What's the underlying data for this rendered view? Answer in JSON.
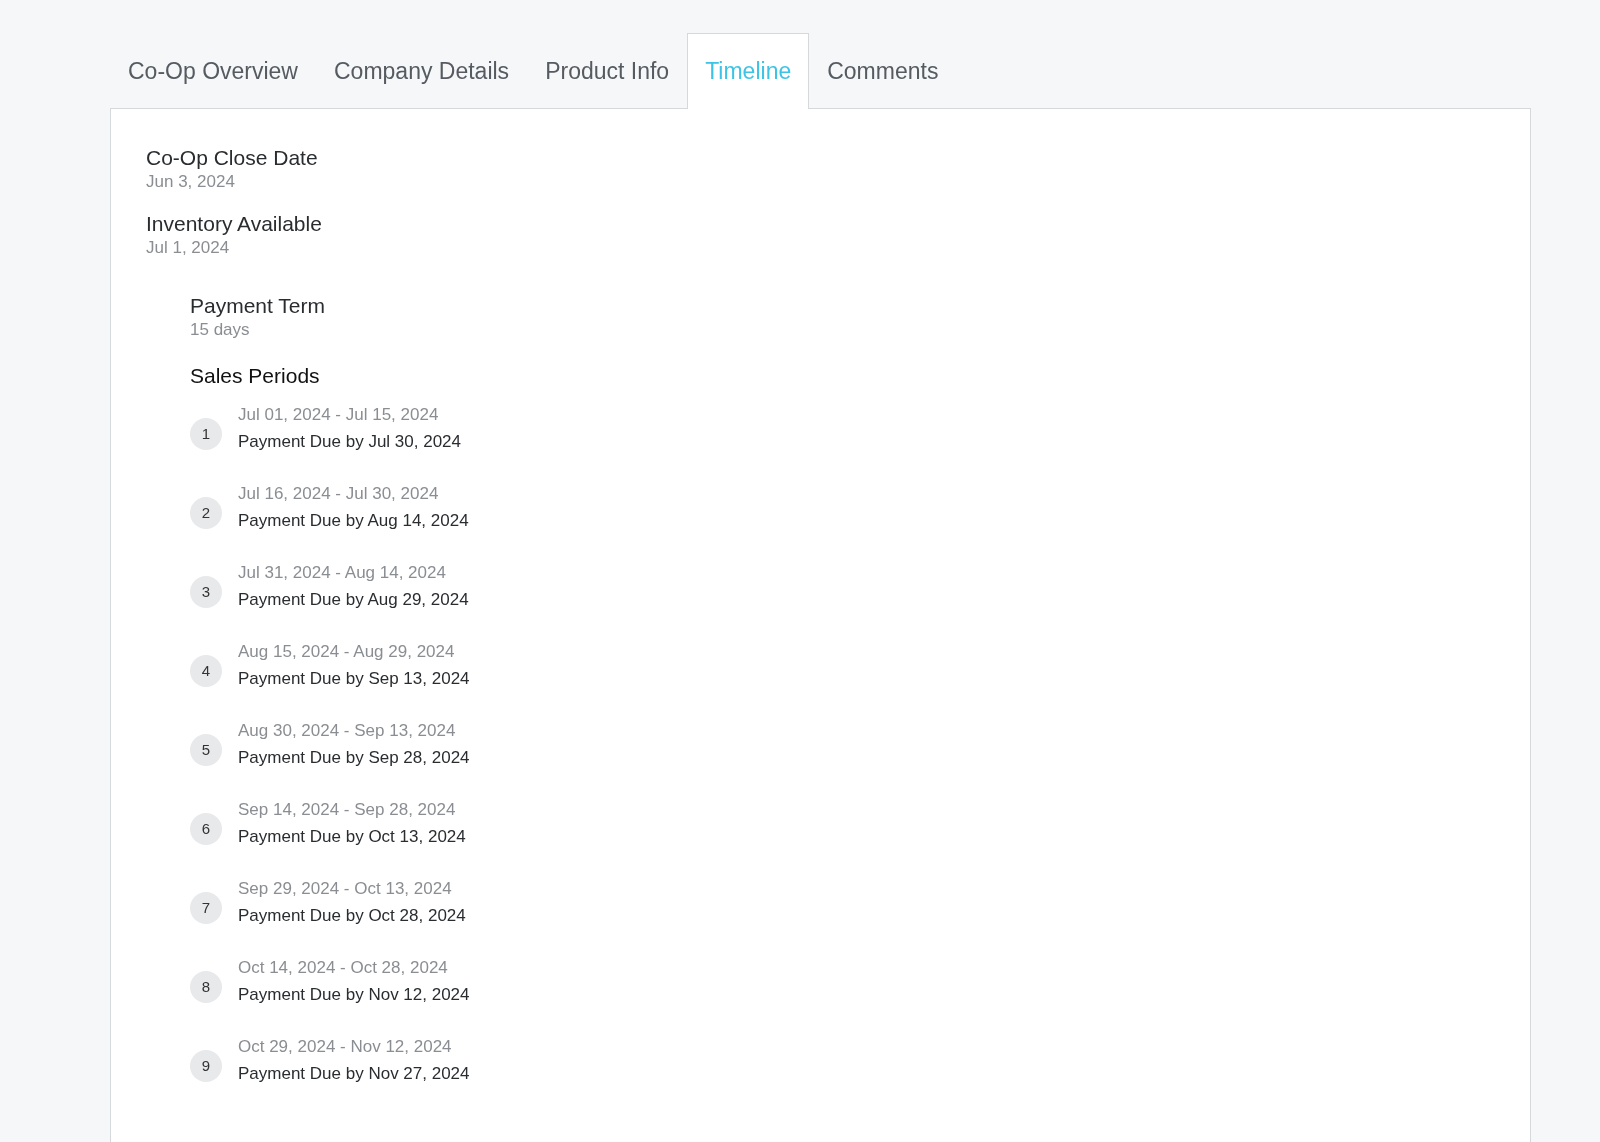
{
  "tabs": [
    {
      "label": "Co-Op Overview",
      "selected": false
    },
    {
      "label": "Company Details",
      "selected": false
    },
    {
      "label": "Product Info",
      "selected": false
    },
    {
      "label": "Timeline",
      "selected": true
    },
    {
      "label": "Comments",
      "selected": false
    }
  ],
  "dates": [
    {
      "label": "Co-Op Close Date",
      "value": "Jun 3, 2024"
    },
    {
      "label": "Inventory Available",
      "value": "Jul 1, 2024"
    }
  ],
  "payment_term": {
    "label": "Payment Term",
    "value": "15 days"
  },
  "sales_periods": {
    "title": "Sales Periods",
    "items": [
      {
        "number": "1",
        "range": "Jul 01, 2024 - Jul 15, 2024",
        "due": "Payment Due by Jul 30, 2024"
      },
      {
        "number": "2",
        "range": "Jul 16, 2024 - Jul 30, 2024",
        "due": "Payment Due by Aug 14, 2024"
      },
      {
        "number": "3",
        "range": "Jul 31, 2024 - Aug 14, 2024",
        "due": "Payment Due by Aug 29, 2024"
      },
      {
        "number": "4",
        "range": "Aug 15, 2024 - Aug 29, 2024",
        "due": "Payment Due by Sep 13, 2024"
      },
      {
        "number": "5",
        "range": "Aug 30, 2024 - Sep 13, 2024",
        "due": "Payment Due by Sep 28, 2024"
      },
      {
        "number": "6",
        "range": "Sep 14, 2024 - Sep 28, 2024",
        "due": "Payment Due by Oct 13, 2024"
      },
      {
        "number": "7",
        "range": "Sep 29, 2024 - Oct 13, 2024",
        "due": "Payment Due by Oct 28, 2024"
      },
      {
        "number": "8",
        "range": "Oct 14, 2024 - Oct 28, 2024",
        "due": "Payment Due by Nov 12, 2024"
      },
      {
        "number": "9",
        "range": "Oct 29, 2024 - Nov 12, 2024",
        "due": "Payment Due by Nov 27, 2024"
      }
    ]
  }
}
